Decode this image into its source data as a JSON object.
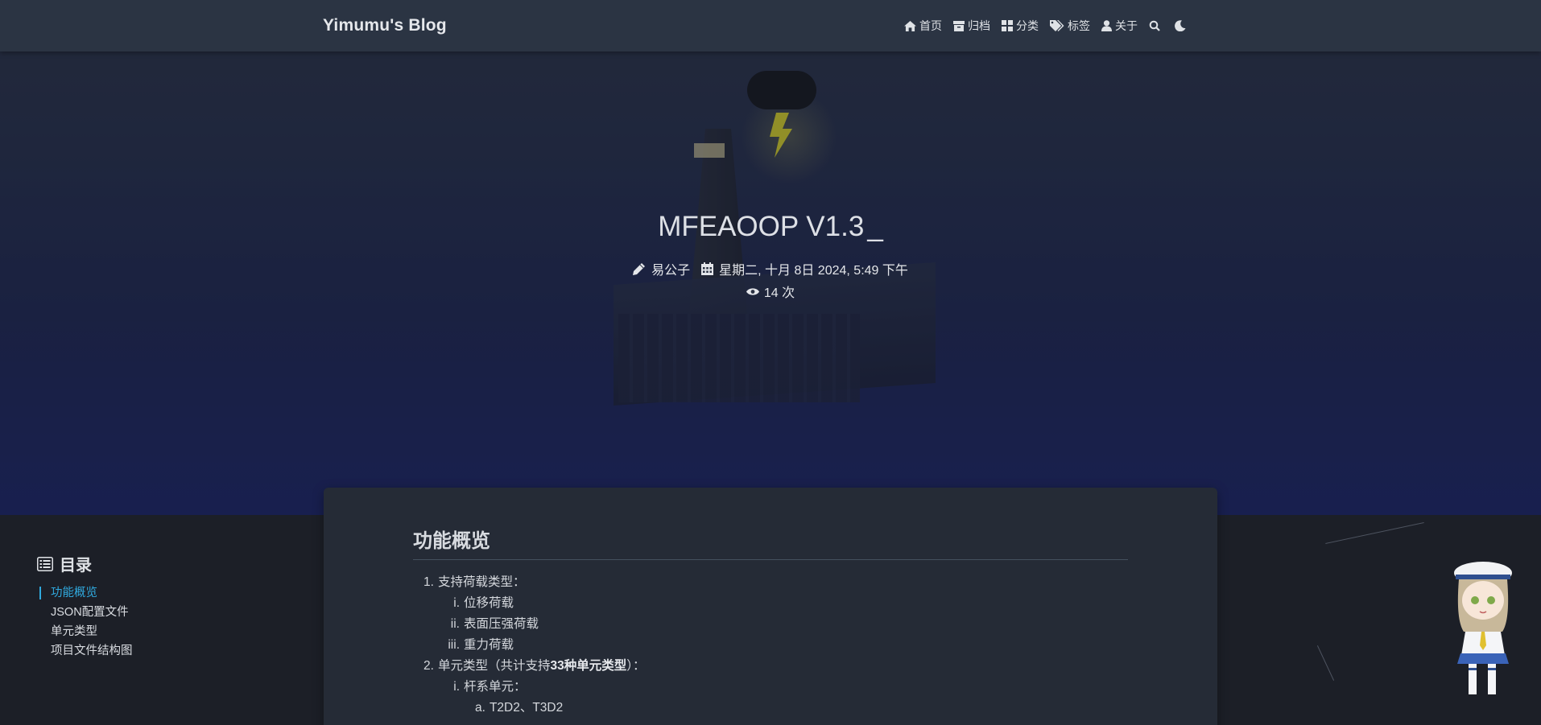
{
  "nav": {
    "brand": "Yimumu's Blog",
    "items": [
      {
        "label": "首页",
        "icon": "home-icon"
      },
      {
        "label": "归档",
        "icon": "archive-icon"
      },
      {
        "label": "分类",
        "icon": "grid-icon"
      },
      {
        "label": "标签",
        "icon": "tags-icon"
      },
      {
        "label": "关于",
        "icon": "user-icon"
      }
    ],
    "search_icon": "search-icon",
    "theme_icon": "moon-icon"
  },
  "hero": {
    "title": "MFEAOOP V1.3",
    "cursor": "_",
    "author": "易公子",
    "date": "星期二, 十月 8日 2024, 5:49 下午",
    "views": "14 次"
  },
  "toc": {
    "title": "目录",
    "items": [
      {
        "label": "功能概览",
        "active": true
      },
      {
        "label": "JSON配置文件",
        "active": false
      },
      {
        "label": "单元类型",
        "active": false
      },
      {
        "label": "项目文件结构图",
        "active": false
      }
    ]
  },
  "article": {
    "heading": "功能概览",
    "list": [
      {
        "num": "1.",
        "text": "支持荷载类型："
      },
      {
        "num": "i.",
        "text": "位移荷载"
      },
      {
        "num": "ii.",
        "text": "表面压强荷载"
      },
      {
        "num": "iii.",
        "text": "重力荷载"
      },
      {
        "num": "2.",
        "text_pre": "单元类型（共计支持",
        "text_bold": "33种单元类型",
        "text_post": "）："
      },
      {
        "num": "i.",
        "text": "杆系单元："
      },
      {
        "num": "a.",
        "text": "T2D2、T3D2"
      }
    ]
  },
  "colors": {
    "accent": "#30a9de",
    "navbar": "#2b3443",
    "card": "#252b36",
    "page": "#1c1f27"
  }
}
